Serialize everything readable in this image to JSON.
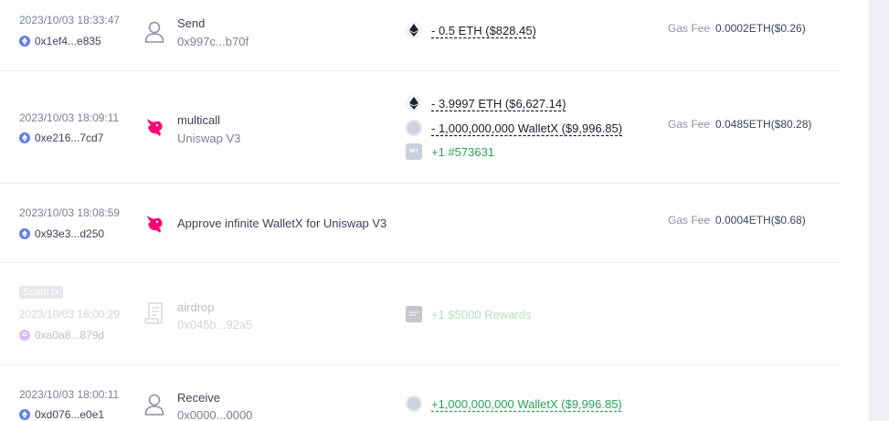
{
  "transactions": [
    {
      "time": "2023/10/03 18:33:47",
      "hash": "0x1ef4...e835",
      "type_title": "Send",
      "type_sub": "0x997c...b70f",
      "tokens": [
        {
          "amount": "- 0.5 ETH ($828.45)",
          "icon": "eth-icon"
        }
      ],
      "gas_label": "Gas Fee",
      "gas_value": "0.0002ETH($0.26)"
    },
    {
      "time": "2023/10/03 18:09:11",
      "hash": "0xe216...7cd7",
      "type_title": "multicall",
      "type_sub": "Uniswap V3",
      "tokens": [
        {
          "amount": "- 3.9997 ETH ($6,627.14)",
          "icon": "eth-icon"
        },
        {
          "amount": "- 1,000,000,000 WalletX ($9,996.85)",
          "icon": "token-icon"
        },
        {
          "amount": "+1 #573631",
          "icon": "nft-icon"
        }
      ],
      "gas_label": "Gas Fee",
      "gas_value": "0.0485ETH($80.28)"
    },
    {
      "time": "2023/10/03 18:08:59",
      "hash": "0x93e3...d250",
      "type_title": "Approve infinite WalletX for Uniswap V3",
      "gas_label": "Gas Fee",
      "gas_value": "0.0004ETH($0.68)"
    },
    {
      "badge": "Scam tx",
      "time": "2023/10/03 18:00:29",
      "hash": "0xa0a8...879d",
      "type_title": "airdrop",
      "type_sub": "0x045b...92a5",
      "tokens": [
        {
          "amount": "+1 $5000 Rewards",
          "icon": "reward-icon"
        }
      ]
    },
    {
      "time": "2023/10/03 18:00:11",
      "hash": "0xd076...e0e1",
      "type_title": "Receive",
      "type_sub": "0x0000...0000",
      "tokens": [
        {
          "amount": "+1,000,000,000 WalletX ($9,996.85)",
          "icon": "token-icon"
        }
      ]
    }
  ],
  "nft_icon_text": "NFT",
  "colors": {
    "positive": "#27a35b",
    "chain": "#627eea",
    "uniswap": "#ff007a"
  }
}
